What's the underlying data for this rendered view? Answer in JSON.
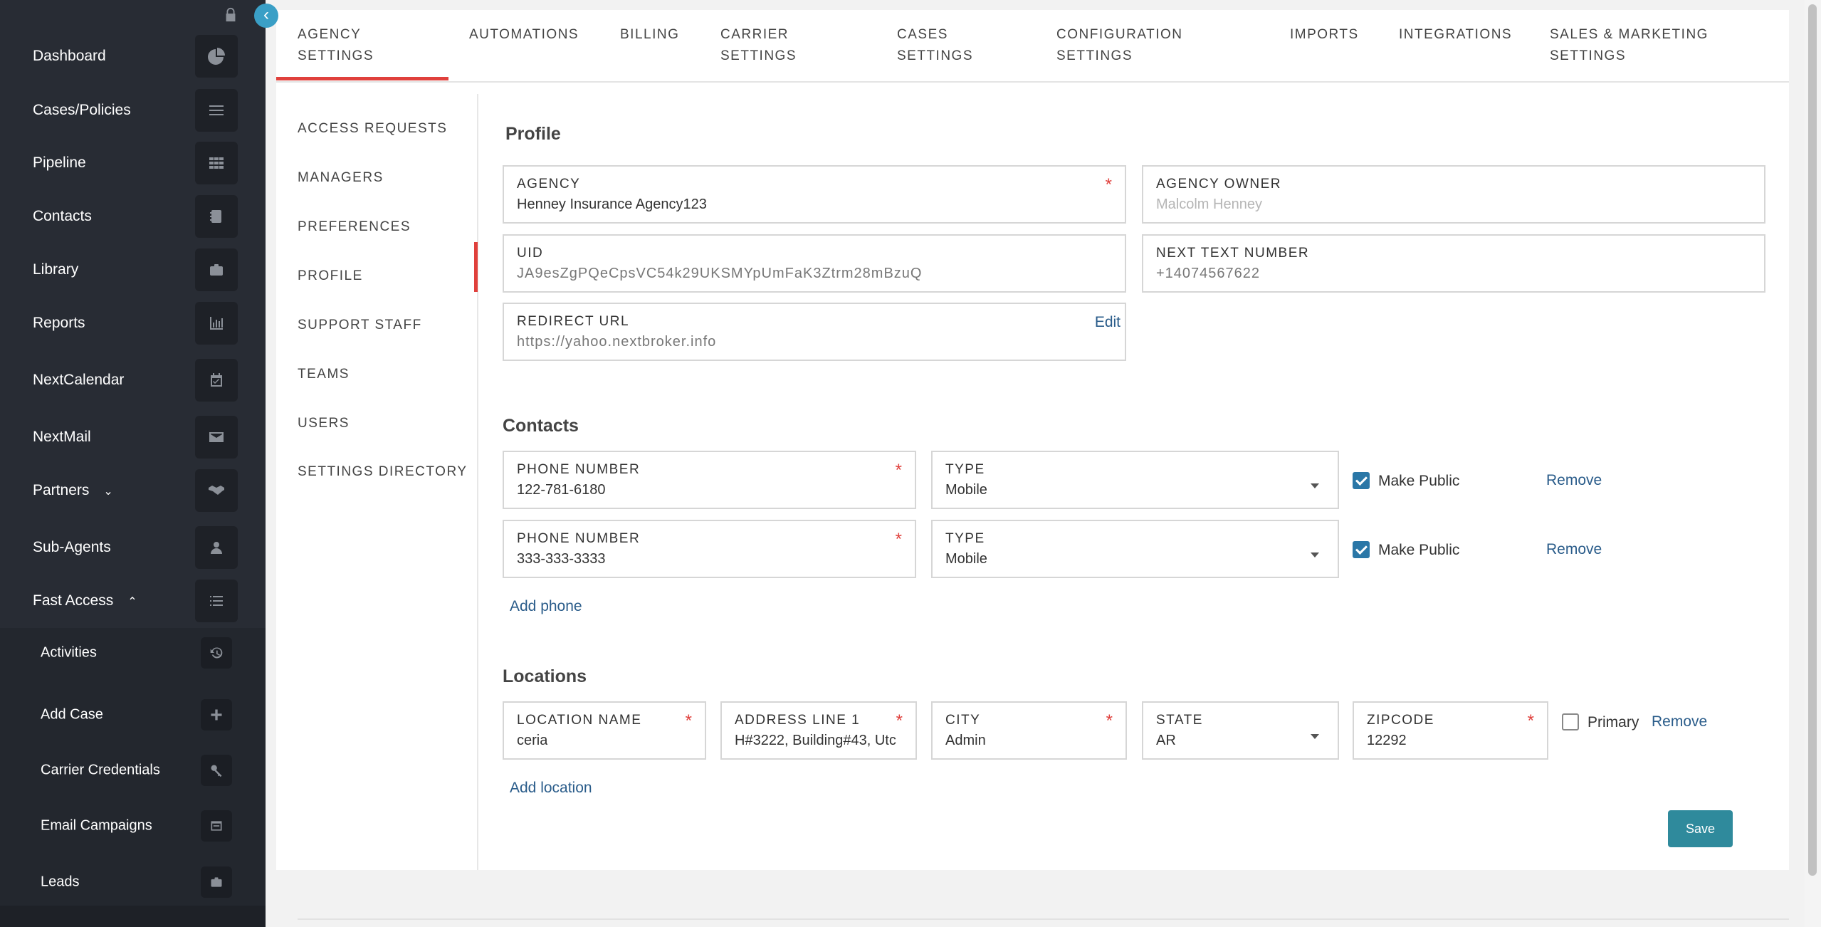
{
  "sidebar": {
    "items": [
      {
        "label": "Dashboard",
        "icon": "pie-chart-icon"
      },
      {
        "label": "Cases/Policies",
        "icon": "list-lines-icon"
      },
      {
        "label": "Pipeline",
        "icon": "grid-icon"
      },
      {
        "label": "Contacts",
        "icon": "address-book-icon"
      },
      {
        "label": "Library",
        "icon": "briefcase-icon"
      },
      {
        "label": "Reports",
        "icon": "bar-chart-icon"
      },
      {
        "label": "NextCalendar",
        "icon": "calendar-check-icon"
      },
      {
        "label": "NextMail",
        "icon": "envelope-icon"
      },
      {
        "label": "Partners",
        "icon": "handshake-icon"
      },
      {
        "label": "Sub-Agents",
        "icon": "user-icon"
      },
      {
        "label": "Fast Access",
        "icon": "list-icon"
      }
    ],
    "fast_access": [
      {
        "label": "Activities",
        "icon": "history-icon"
      },
      {
        "label": "Add Case",
        "icon": "plus-icon"
      },
      {
        "label": "Carrier Credentials",
        "icon": "key-icon"
      },
      {
        "label": "Email Campaigns",
        "icon": "window-icon"
      },
      {
        "label": "Leads",
        "icon": "briefcase-icon"
      }
    ]
  },
  "tabs": [
    {
      "label": "AGENCY",
      "label2": "SETTINGS"
    },
    {
      "label": "AUTOMATIONS",
      "label2": ""
    },
    {
      "label": "BILLING",
      "label2": ""
    },
    {
      "label": "CARRIER",
      "label2": "SETTINGS"
    },
    {
      "label": "CASES",
      "label2": "SETTINGS"
    },
    {
      "label": "CONFIGURATION",
      "label2": "SETTINGS"
    },
    {
      "label": "IMPORTS",
      "label2": ""
    },
    {
      "label": "INTEGRATIONS",
      "label2": ""
    },
    {
      "label": "SALES & MARKETING",
      "label2": "SETTINGS"
    }
  ],
  "left_nav": [
    "ACCESS REQUESTS",
    "MANAGERS",
    "PREFERENCES",
    "PROFILE",
    "SUPPORT STAFF",
    "TEAMS",
    "USERS",
    "SETTINGS DIRECTORY"
  ],
  "profile": {
    "title": "Profile",
    "agency": {
      "label": "AGENCY",
      "value": "Henney Insurance Agency123"
    },
    "agency_owner": {
      "label": "AGENCY OWNER",
      "placeholder": "Malcolm Henney"
    },
    "uid": {
      "label": "UID",
      "value": "JA9esZgPQeCpsVC54k29UKSMYpUmFaK3Ztrm28mBzuQ"
    },
    "next_text_number": {
      "label": "NEXT TEXT NUMBER",
      "value": "+14074567622"
    },
    "redirect_url": {
      "label": "REDIRECT URL",
      "value": "https://yahoo.nextbroker.info",
      "action": "Edit"
    },
    "required_mark": "*"
  },
  "contacts": {
    "title": "Contacts",
    "phones": [
      {
        "label": "PHONE NUMBER",
        "value": "122-781-6180",
        "type_label": "TYPE",
        "type": "Mobile",
        "public_label": "Make Public",
        "public": true,
        "remove": "Remove"
      },
      {
        "label": "PHONE NUMBER",
        "value": "333-333-3333",
        "type_label": "TYPE",
        "type": "Mobile",
        "public_label": "Make Public",
        "public": true,
        "remove": "Remove"
      }
    ],
    "add_phone": "Add phone"
  },
  "locations": {
    "title": "Locations",
    "rows": [
      {
        "name_label": "LOCATION NAME",
        "name": "ceria",
        "address_label": "ADDRESS LINE 1",
        "address": "H#3222, Building#43, Utc",
        "city_label": "CITY",
        "city": "Admin",
        "state_label": "STATE",
        "state": "AR",
        "zip_label": "ZIPCODE",
        "zip": "12292",
        "primary_label": "Primary",
        "primary": false,
        "remove": "Remove"
      }
    ],
    "add_location": "Add location"
  },
  "actions": {
    "save": "Save"
  },
  "colors": {
    "accent_red": "#e0403c",
    "button_teal": "#2f8a9c",
    "link_blue": "#2a5c8a",
    "sidebar_bg": "#282c34"
  }
}
